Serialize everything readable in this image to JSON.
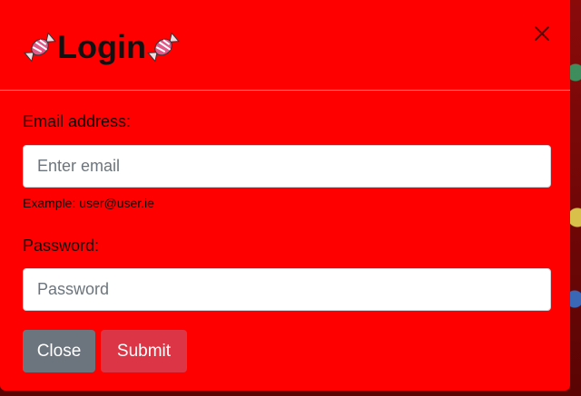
{
  "modal": {
    "title": "Login",
    "title_icon": "candy-icon",
    "close_icon": "close-icon"
  },
  "form": {
    "email_label": "Email address:",
    "email_placeholder": "Enter email",
    "email_value": "",
    "email_hint": "Example: user@user.ie",
    "password_label": "Password:",
    "password_placeholder": "Password",
    "password_value": ""
  },
  "buttons": {
    "close_label": "Close",
    "submit_label": "Submit"
  },
  "colors": {
    "modal_background": "#ff0000",
    "close_button": "#6c757d",
    "submit_button": "#dc3545"
  }
}
